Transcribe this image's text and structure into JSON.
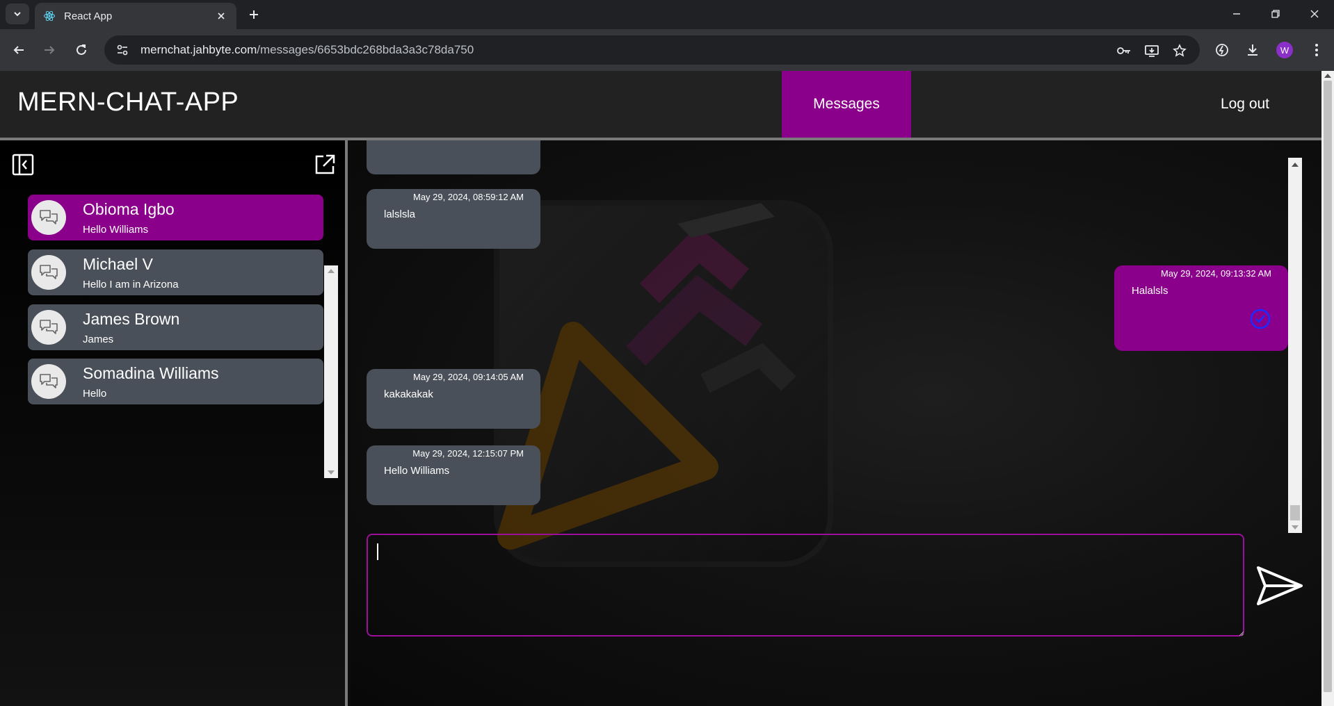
{
  "browser": {
    "tab_title": "React App",
    "url_host": "mernchat.jahbyte.com",
    "url_path": "/messages/6653bdc268bda3a3c78da750",
    "profile_initial": "W"
  },
  "app": {
    "brand": "MERN-CHAT-APP",
    "nav_messages": "Messages",
    "nav_logout": "Log out"
  },
  "conversations": [
    {
      "name": "Obioma Igbo",
      "last_message": "Hello Williams",
      "active": true
    },
    {
      "name": "Michael V",
      "last_message": "Hello I am in Arizona",
      "active": false
    },
    {
      "name": "James Brown",
      "last_message": "James",
      "active": false
    },
    {
      "name": "Somadina Williams",
      "last_message": "Hello",
      "active": false
    }
  ],
  "messages": [
    {
      "timestamp": "",
      "text": "",
      "mine": false
    },
    {
      "timestamp": "May 29, 2024, 08:59:12 AM",
      "text": "lalslsla",
      "mine": false
    },
    {
      "timestamp": "May 29, 2024, 09:13:32 AM",
      "text": "Halalsls",
      "mine": true
    },
    {
      "timestamp": "May 29, 2024, 09:14:05 AM",
      "text": "kakakakak",
      "mine": false
    },
    {
      "timestamp": "May 29, 2024, 12:15:07 PM",
      "text": "Hello Williams",
      "mine": false
    }
  ],
  "composer": {
    "value": "",
    "placeholder": ""
  },
  "colors": {
    "accent": "#8b008b",
    "bubble": "#4a5059",
    "header": "#222222"
  }
}
